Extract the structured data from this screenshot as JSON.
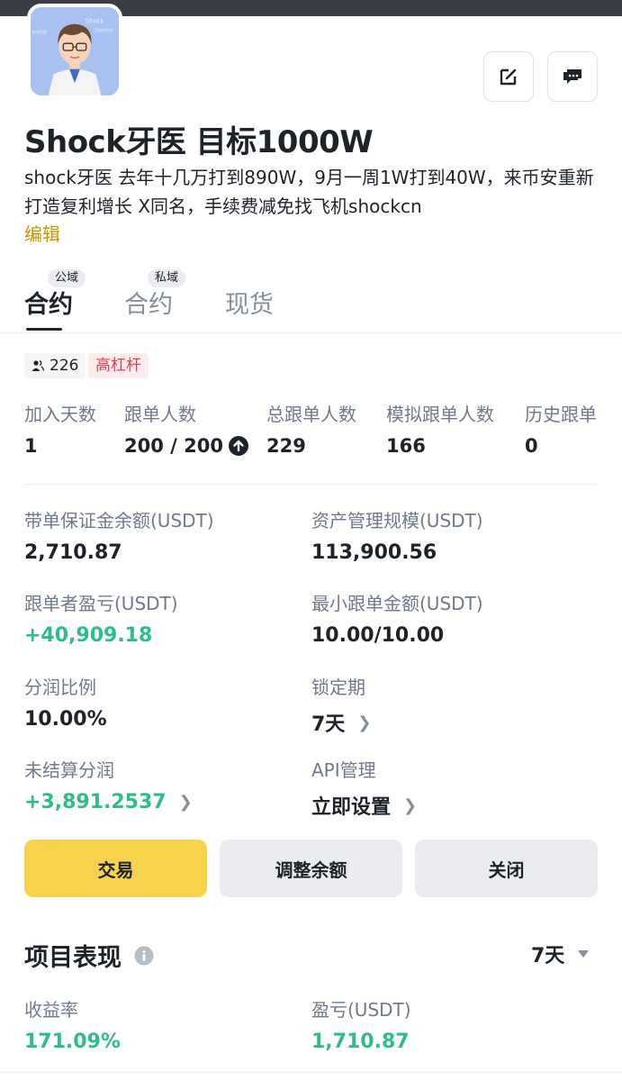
{
  "profile": {
    "avatar_alt": "avatar",
    "title": "Shock牙医 目标1000W",
    "bio": "shock牙医 去年十几万打到890W，9月一周1W打到40W，来币安重新打造复利增长 X同名，手续费减免找飞机shockcn",
    "edit_label": "编辑"
  },
  "header_actions": {
    "edit_icon": "edit-icon",
    "chat_icon": "chat-icon"
  },
  "tabs": [
    {
      "label": "合约",
      "badge": "公域",
      "active": true
    },
    {
      "label": "合约",
      "badge": "私域",
      "active": false
    },
    {
      "label": "现货",
      "badge": "",
      "active": false
    }
  ],
  "chips": {
    "followers": "226",
    "leverage": "高杠杆"
  },
  "stats": [
    {
      "label": "加入天数",
      "value": "1"
    },
    {
      "label": "跟单人数",
      "value": "200 / 200"
    },
    {
      "label": "总跟单人数",
      "value": "229"
    },
    {
      "label": "模拟跟单人数",
      "value": "166"
    },
    {
      "label": "历史跟单",
      "value": "0"
    }
  ],
  "fields": {
    "margin_balance": {
      "label": "带单保证金余额(USDT)",
      "value": "2,710.87"
    },
    "aum": {
      "label": "资产管理规模(USDT)",
      "value": "113,900.56"
    },
    "follower_pnl": {
      "label": "跟单者盈亏(USDT)",
      "value": "+40,909.18"
    },
    "min_copy_amount": {
      "label": "最小跟单金额(USDT)",
      "value": "10.00/10.00"
    },
    "profit_share": {
      "label": "分润比例",
      "value": "10.00%"
    },
    "lock_period": {
      "label": "锁定期",
      "value": "7天"
    },
    "unsettled_share": {
      "label": "未结算分润",
      "value": "+3,891.2537"
    },
    "api_mgmt": {
      "label": "API管理",
      "value": "立即设置"
    }
  },
  "buttons": {
    "trade": "交易",
    "adjust": "调整余额",
    "close": "关闭"
  },
  "performance": {
    "title": "项目表现",
    "period": "7天",
    "roi_label": "收益率",
    "roi_value": "171.09%",
    "pnl_label": "盈亏(USDT)",
    "pnl_value": "1,710.87"
  },
  "colors": {
    "accent": "#f6d34b",
    "positive": "#2ebd85",
    "link": "#c99400",
    "tag_red": "#e2404d"
  }
}
